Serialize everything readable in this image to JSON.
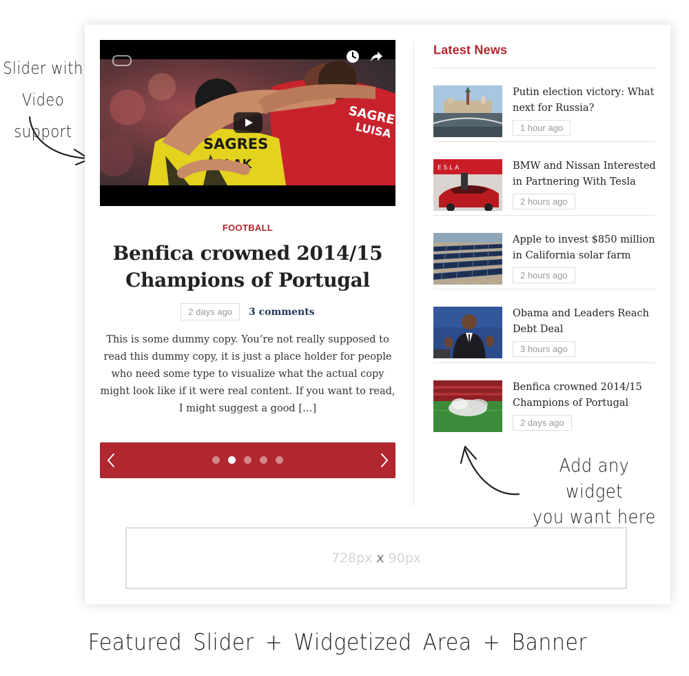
{
  "annotations": {
    "left_note_line1": "Slider with",
    "left_note_line2": "Video support",
    "right_note_line1": "Add any widget",
    "right_note_line2": "you want here",
    "caption": "Featured Slider + Widgetized Area + Banner"
  },
  "slider": {
    "category": "FOOTBALL",
    "title": "Benfica crowned 2014/15 Champions of Portugal",
    "date": "2 days ago",
    "comments": "3 comments",
    "excerpt": "This is some dummy copy. You’re not really supposed to read this dummy copy, it is just a place holder for people who need some type to visualize what the actual copy might look like if it were real content. If you want to read, I might suggest a good […]",
    "video_text": {
      "shirt_sponsor": "SAGRES",
      "player_name": "OBLAK",
      "rear_text_1": "SAGRE",
      "rear_text_2": "LUISA"
    },
    "dots_count": 5,
    "active_dot": 1,
    "controls": {
      "prev_icon": "chevron-left-icon",
      "next_icon": "chevron-right-icon",
      "play_icon": "play-icon",
      "clock_icon": "clock-icon",
      "share_icon": "share-icon"
    }
  },
  "sidebar": {
    "widget_title": "Latest News",
    "items": [
      {
        "title": "Putin election victory: What next for Russia?",
        "date": "1 hour ago",
        "thumb": "kremlin"
      },
      {
        "title": "BMW and Nissan Interested in Partnering With Tesla",
        "date": "2 hours ago",
        "thumb": "tesla",
        "thumb_text": "E S L A"
      },
      {
        "title": "Apple to invest $850 million in California solar farm",
        "date": "2 hours ago",
        "thumb": "solar"
      },
      {
        "title": "Obama and Leaders Reach Debt Deal",
        "date": "3 hours ago",
        "thumb": "speaker"
      },
      {
        "title": "Benfica crowned 2014/15 Champions of Portugal",
        "date": "2 days ago",
        "thumb": "stadium"
      }
    ]
  },
  "banner": {
    "width_label": "728px",
    "separator": "x",
    "height_label": "90px"
  },
  "colors": {
    "accent": "#b0272f",
    "link": "#1f3658",
    "muted": "#999999",
    "border": "#dddddd"
  }
}
